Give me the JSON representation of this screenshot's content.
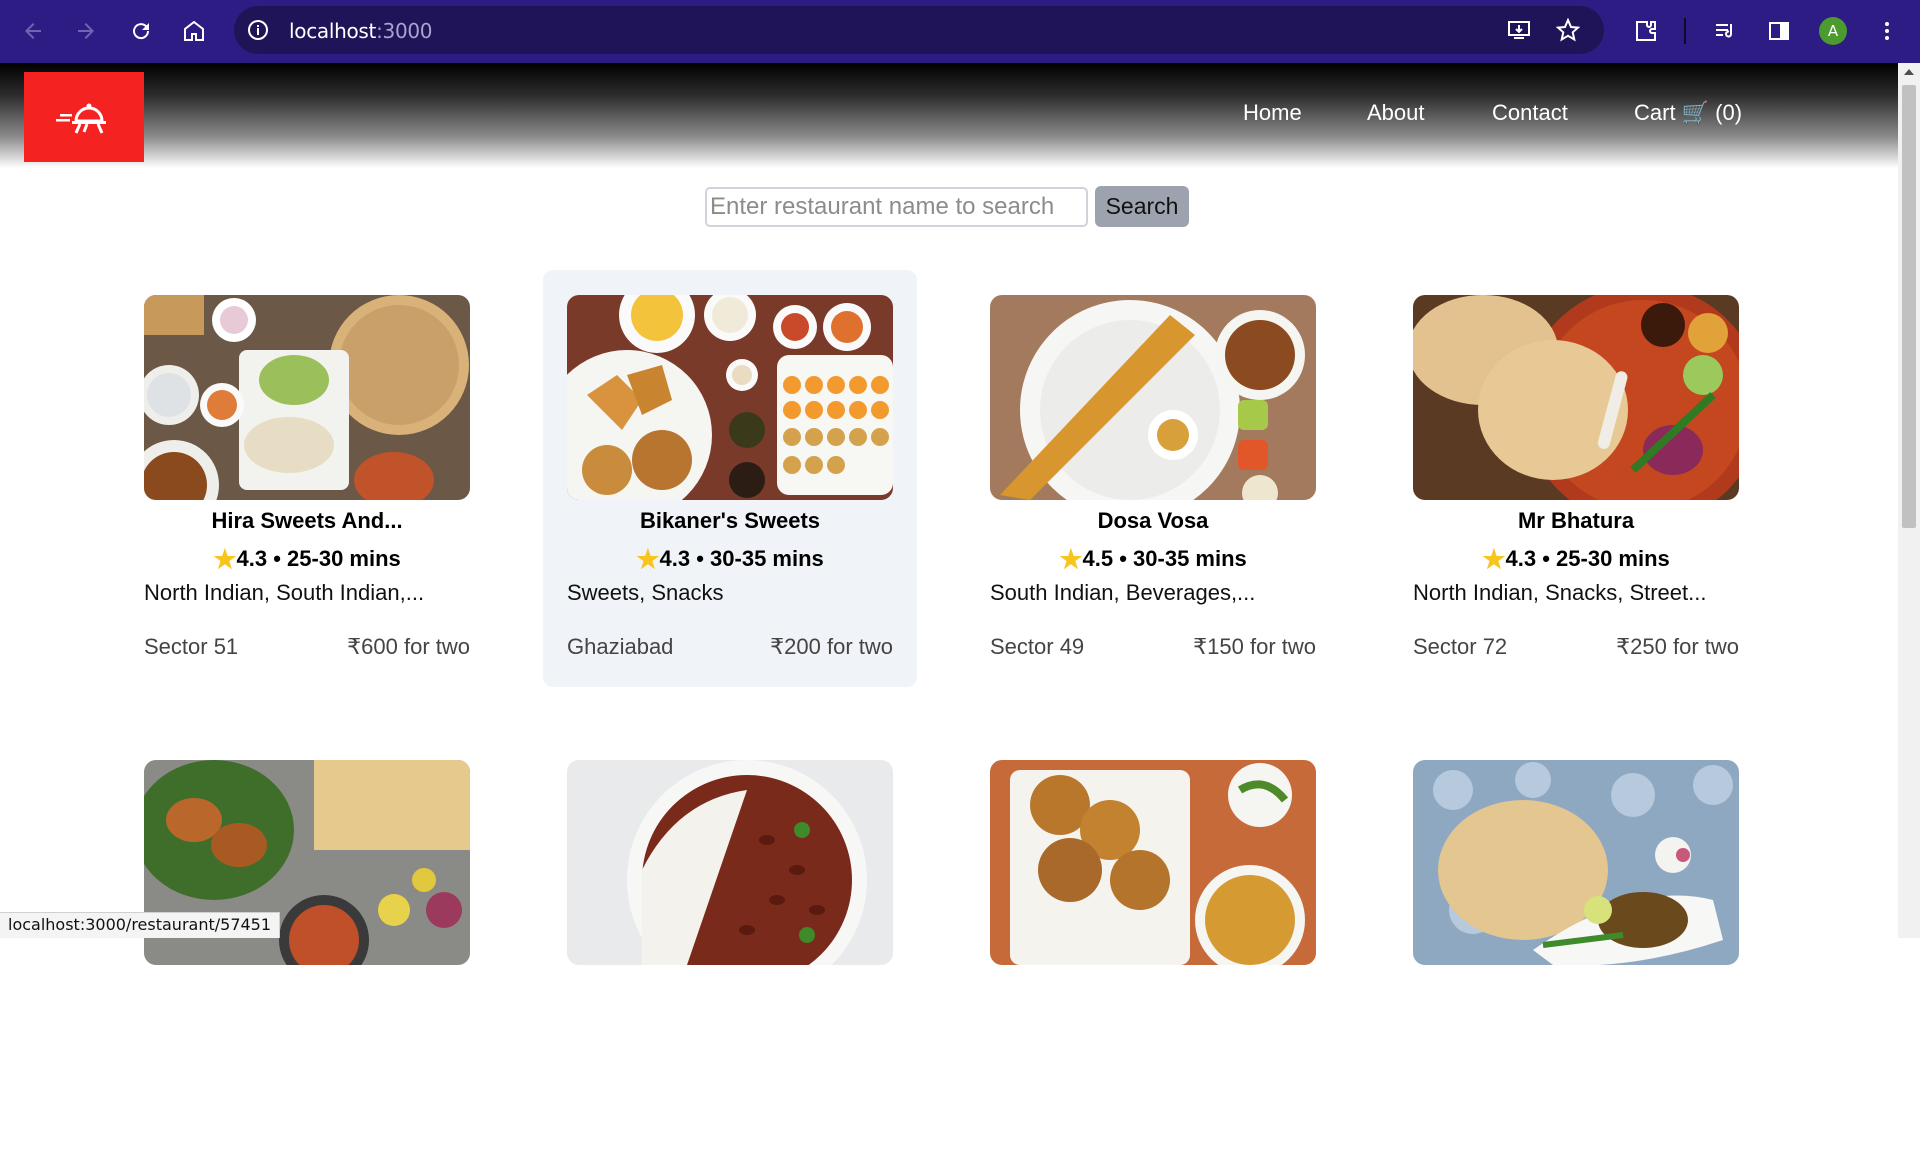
{
  "browser": {
    "url_host": "localhost",
    "url_port": ":3000",
    "avatar_letter": "A",
    "icons": [
      "back-icon",
      "forward-icon",
      "reload-icon",
      "home-icon",
      "site-info-icon",
      "install-icon",
      "bookmark-star-icon",
      "extensions-icon",
      "media-icon",
      "side-panel-icon",
      "menu-icon"
    ],
    "chrome_color": "#2d1c83"
  },
  "header": {
    "logo": "food-delivery-logo",
    "logo_bg": "#f52222",
    "nav": {
      "home": "Home",
      "about": "About",
      "contact": "Contact",
      "cart": "Cart 🛒 (0)"
    }
  },
  "search": {
    "placeholder": "Enter restaurant name to search",
    "button": "Search"
  },
  "restaurants": [
    {
      "name": "Hira Sweets And...",
      "rating": "4.3",
      "eta": "25-30 mins",
      "meta": "4.3 • 25-30 mins",
      "cuisines": "North Indian, South Indian,...",
      "area": "Sector 51",
      "cost": "₹600 for two"
    },
    {
      "name": "Bikaner's Sweets",
      "rating": "4.3",
      "eta": "30-35 mins",
      "meta": "4.3 • 30-35 mins",
      "cuisines": "Sweets, Snacks",
      "area": "Ghaziabad",
      "cost": "₹200 for two"
    },
    {
      "name": "Dosa Vosa",
      "rating": "4.5",
      "eta": "30-35 mins",
      "meta": "4.5 • 30-35 mins",
      "cuisines": "South Indian, Beverages,...",
      "area": "Sector 49",
      "cost": "₹150 for two"
    },
    {
      "name": "Mr Bhatura",
      "rating": "4.3",
      "eta": "25-30 mins",
      "meta": "4.3 • 25-30 mins",
      "cuisines": "North Indian, Snacks, Street...",
      "area": "Sector 72",
      "cost": "₹250 for two"
    }
  ],
  "status_bar": {
    "link": "localhost:3000/restaurant/57451"
  }
}
